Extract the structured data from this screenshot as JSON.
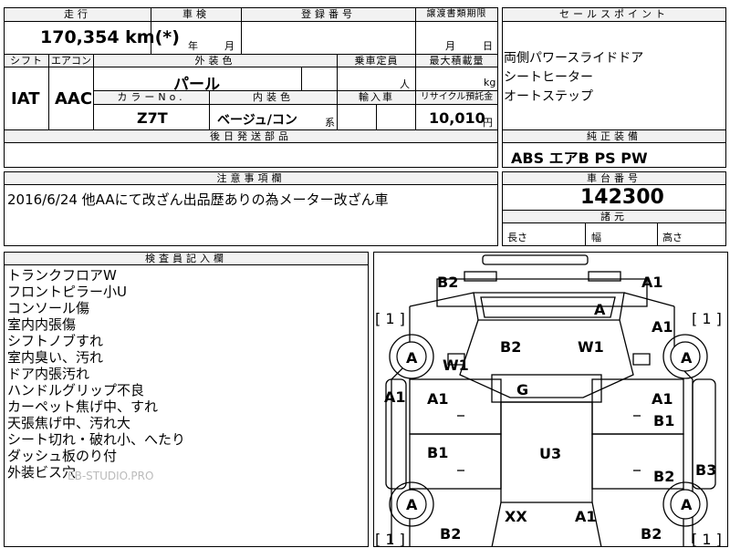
{
  "vehicle": {
    "mileage": "170,354 km(*)",
    "shaken_year": "年",
    "shaken_month": "月",
    "transfer_month": "月",
    "transfer_day": "日",
    "shift": "IAT",
    "aircon": "AAC",
    "exterior_color": "パール",
    "color_no": "Z7T",
    "interior_color": "ベージュ/コン",
    "interior_suffix": "系",
    "capacity_unit": "人",
    "max_load_unit": "kg",
    "recycle_fee": "10,010",
    "recycle_unit": "円",
    "chassis_no": "142300"
  },
  "labels": {
    "mileage": "走行",
    "shaken": "車検",
    "registration": "登録番号",
    "transfer_deadline": "譲渡書類期限",
    "shift": "シフト",
    "aircon": "エアコン",
    "exterior_color": "外装色",
    "capacity": "乗車定員",
    "max_load": "最大積載量",
    "color_no": "カラーNo.",
    "interior_color": "内装色",
    "import": "輸入車",
    "recycle": "リサイクル預託金",
    "later_parts": "後日発送部品",
    "sales_points": "セールスポイント",
    "standard_equipment": "純正装備",
    "notes": "注意事項欄",
    "chassis_no": "車台番号",
    "dimensions": "諸元",
    "length": "長さ",
    "width": "幅",
    "height": "高さ",
    "inspector": "検査員記入欄"
  },
  "sales_points": [
    "両側パワースライドドア",
    "シートヒーター",
    "オートステップ"
  ],
  "standard_equipment": "ABS エアB PS PW",
  "notes": "2016/6/24 他AAにて改ざん出品歴ありの為メーター改ざん車",
  "inspector_notes": [
    "トランクフロアW",
    "フロントピラー小U",
    "コンソール傷",
    "室内内張傷",
    "シフトノブすれ",
    "室内臭い、汚れ",
    "ドア内張汚れ",
    "ハンドルグリップ不良",
    "カーペット焦げ中、すれ",
    "天張焦げ中、汚れ大",
    "シート切れ・破れ小、へたり",
    "ダッシュ板のり付",
    "外装ビス穴"
  ],
  "watermark": "EB-STUDIO.PRO",
  "diagram_marks": {
    "b2_top_left": "B2",
    "a1_top_right": "A1",
    "a_windshield": "A",
    "bracket_left_top": "[ 1 ]",
    "bracket_right_top": "[ 1 ]",
    "a1_front_right_fender": "A1",
    "b2_hood": "B2",
    "w1_hood": "W1",
    "w1_left": "W1",
    "a_front_left_tire": "A",
    "a_front_right_tire": "A",
    "g_roof": "G",
    "a1_left_side": "A1",
    "a1_front_left_door": "A1",
    "a1_front_right_door": "A1",
    "b1_front_right_door": "B1",
    "b1_rear_left_door": "B1",
    "u3_center": "U3",
    "b2_rear_right_door": "B2",
    "b3_right_side": "B3",
    "a_rear_left_tire": "A",
    "a_rear_right_tire": "A",
    "xx_rear": "XX",
    "a1_rear": "A1",
    "b2_rear_left": "B2",
    "b2_rear_right": "B2",
    "bracket_left_bottom": "[ 1 ]",
    "bracket_right_bottom": "[ 1 ]"
  }
}
